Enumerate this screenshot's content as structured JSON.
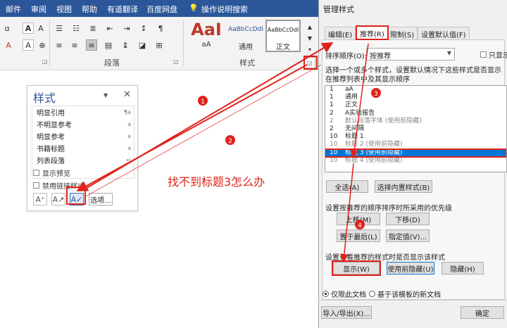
{
  "menubar": {
    "items": [
      "邮件",
      "审阅",
      "视图",
      "帮助",
      "有道翻译",
      "百度网盘",
      "操作说明搜索"
    ]
  },
  "ribbon": {
    "paragraph_label": "段落",
    "styles_label": "样式",
    "style_previews": [
      {
        "big": "AaI",
        "name": "aA"
      },
      {
        "big": "AaBbCcDdI",
        "name": "通用"
      },
      {
        "big": "AaBbCcDdI",
        "name": "正文"
      }
    ]
  },
  "styles_pane": {
    "title": "样式",
    "items": [
      {
        "name": "明显引用",
        "mark": "¶a"
      },
      {
        "name": "不明显参考",
        "mark": "a"
      },
      {
        "name": "明显参考",
        "mark": "a"
      },
      {
        "name": "书籍标题",
        "mark": "a"
      },
      {
        "name": "列表段落",
        "mark": "↵"
      }
    ],
    "show_preview": "显示预览",
    "disable_linked": "禁用链接样式",
    "options_button": "选项..."
  },
  "annotation": {
    "question": "找不到标题3怎么办",
    "markers": [
      "1",
      "2",
      "3",
      "4"
    ]
  },
  "dialog": {
    "title": "管理样式",
    "tabs": [
      "编辑(E)",
      "推荐(R)",
      "限制(S)",
      "设置默认值(F)"
    ],
    "sort_label": "排序顺序(O):",
    "sort_value": "按推荐",
    "only_show": "只显示",
    "instruction": "选择一个或多个样式，设置默认情况下这些样式是否显示在推荐列表中及其显示顺序",
    "styles": [
      {
        "priority": "1",
        "name": "aA"
      },
      {
        "priority": "1",
        "name": "通用"
      },
      {
        "priority": "1",
        "name": "正文"
      },
      {
        "priority": "2",
        "name": "A实验报告"
      },
      {
        "priority": "2",
        "name": "默认段落字体 (使用前隐藏)"
      },
      {
        "priority": "2",
        "name": "无间隔"
      },
      {
        "priority": "10",
        "name": "标题 1"
      },
      {
        "priority": "10",
        "name": "标题 2 (使用前隐藏)"
      },
      {
        "priority": "10",
        "name": "标题 3 (使用前隐藏)"
      },
      {
        "priority": "10",
        "name": "标题 4 (使用前隐藏)"
      }
    ],
    "select_all": "全选(A)",
    "select_builtin": "选择内置样式(B)",
    "priority_label": "设置按推荐的顺序排序时所采用的优先级",
    "move_up": "上移(M)",
    "move_down": "下移(D)",
    "move_last": "置于最后(L)",
    "assign_value": "指定值(V)...",
    "visibility_label": "设置查看推荐的样式时是否显示该样式",
    "show": "显示(W)",
    "hide_until_used": "使用前隐藏(U)",
    "hide": "隐藏(H)",
    "only_this_doc": "仅限此文档",
    "new_docs": "基于该模板的新文档",
    "import_export": "导入/导出(X)...",
    "ok": "确定"
  }
}
